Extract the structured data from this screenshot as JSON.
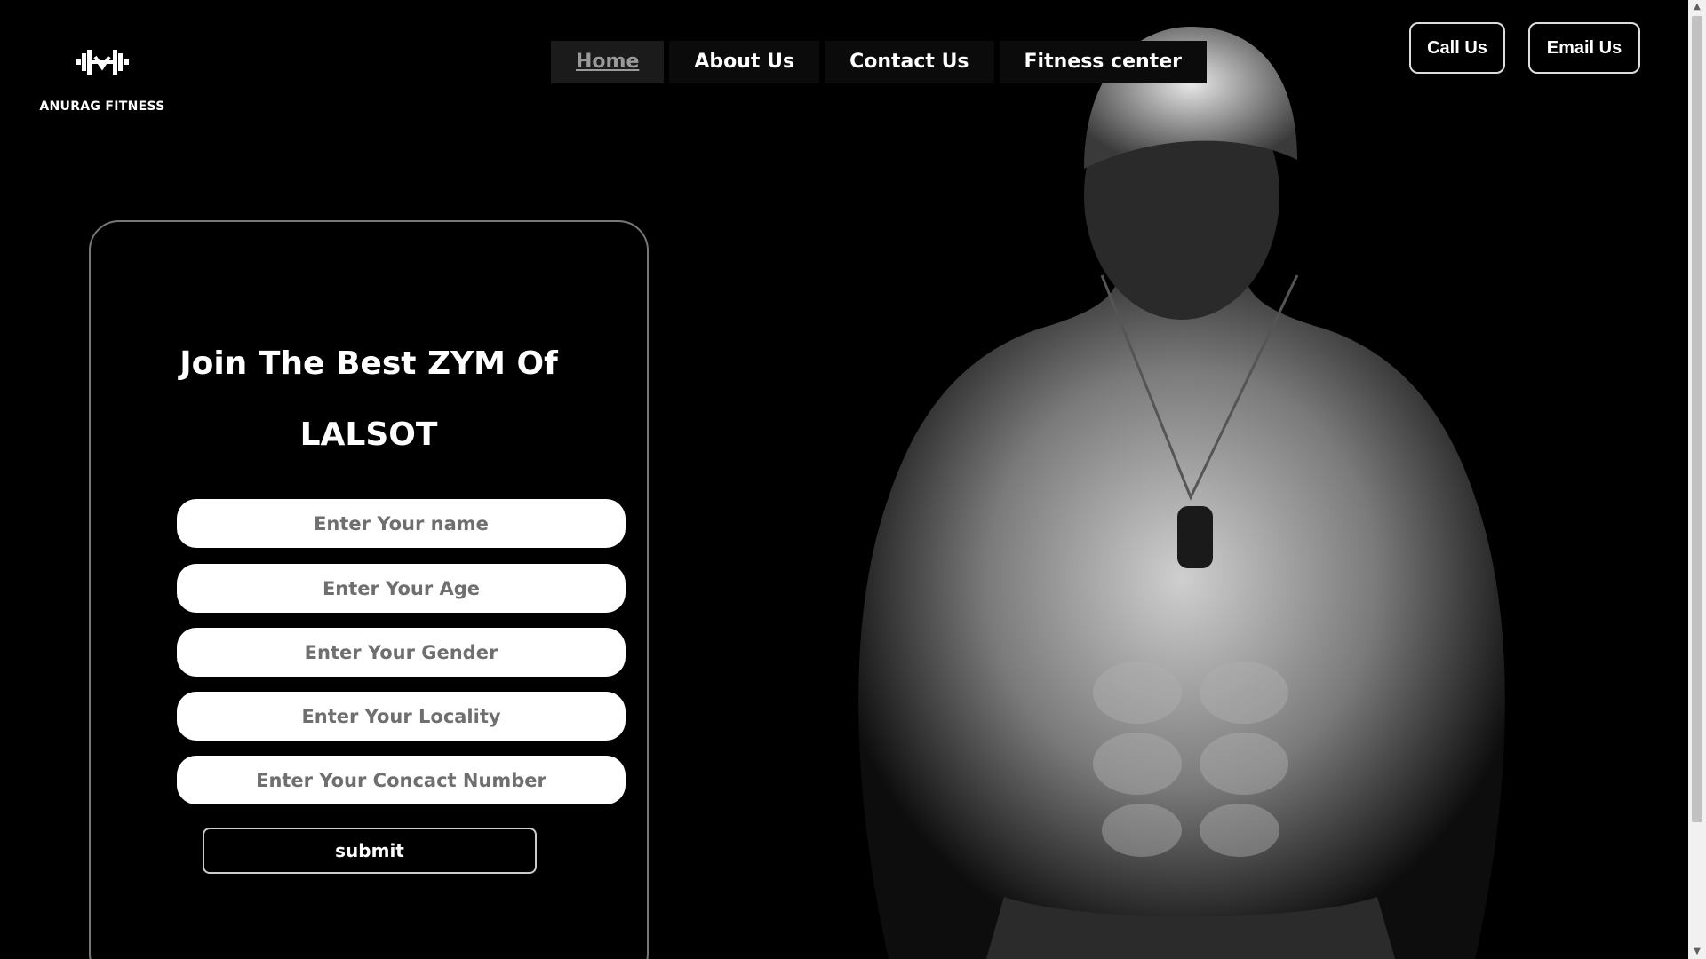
{
  "brand": {
    "logo_icon": "dumbbell-icon",
    "name": "ANURAG FITNESS"
  },
  "nav": {
    "items": [
      {
        "label": "Home",
        "active": true
      },
      {
        "label": "About Us"
      },
      {
        "label": "Contact Us"
      },
      {
        "label": "Fitness center"
      }
    ]
  },
  "header_actions": {
    "call": "Call Us",
    "email": "Email Us"
  },
  "form": {
    "title_line1": "Join The Best ZYM Of",
    "title_line2": "LALSOT",
    "fields": [
      {
        "placeholder": "Enter Your name"
      },
      {
        "placeholder": "Enter Your Age"
      },
      {
        "placeholder": "Enter Your Gender"
      },
      {
        "placeholder": "Enter Your Locality"
      },
      {
        "placeholder": "Enter Your Concact Number"
      }
    ],
    "submit": "submit"
  },
  "colors": {
    "background": "#000000",
    "text": "#ffffff",
    "input_bg": "#ffffff",
    "active_nav_text": "#9a9a9a"
  }
}
